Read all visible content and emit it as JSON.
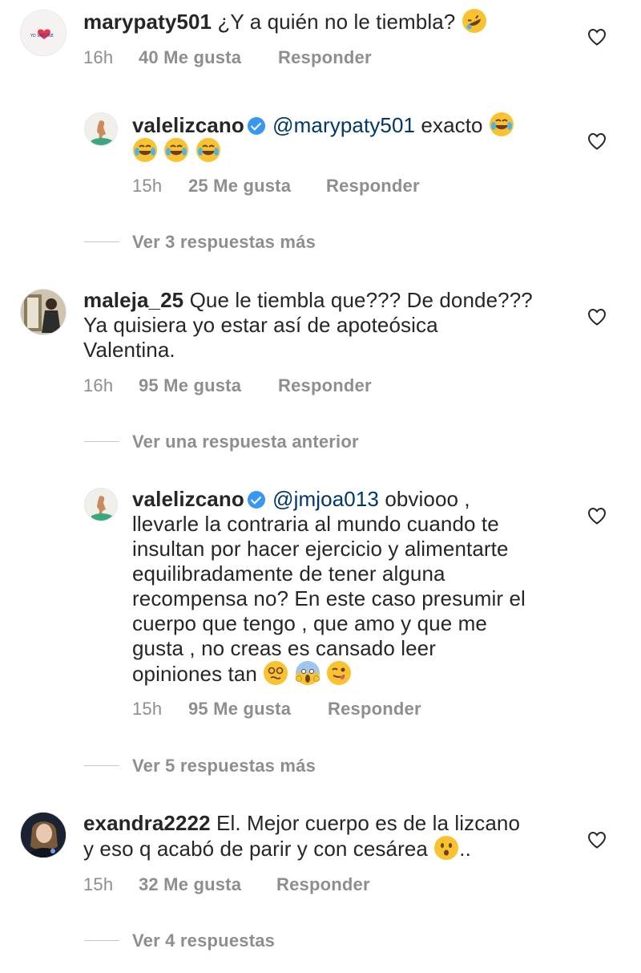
{
  "comments": [
    {
      "username": "marypaty501",
      "text": "¿Y a quién no le tiembla?",
      "emoji": "rolling-on-floor-laughing",
      "time": "16h",
      "likes": "40 Me gusta",
      "reply": "Responder",
      "avatar_logo": "YO VACUNÉ"
    },
    {
      "username": "valelizcano",
      "verified": true,
      "mention": "@marypaty501",
      "text": "exacto",
      "emojis": [
        "face-with-tears-of-joy",
        "face-with-tears-of-joy",
        "face-with-tears-of-joy",
        "face-with-tears-of-joy"
      ],
      "time": "15h",
      "likes": "25 Me gusta",
      "reply": "Responder"
    },
    {
      "username": "maleja_25",
      "text_lines": [
        "Que le tiembla que??? De donde???",
        "Ya quisiera yo estar así de apoteósica",
        "Valentina."
      ],
      "time": "16h",
      "likes": "95 Me gusta",
      "reply": "Responder"
    },
    {
      "username": "valelizcano",
      "verified": true,
      "mention": "@jmjoa013",
      "text_lines": [
        "obviooo ,",
        "llevarle la contraria al mundo cuando te",
        "insultan por hacer ejercicio y alimentarte",
        "equilibradamente de tener alguna",
        "recompensa no? En este caso presumir el",
        "cuerpo que tengo , que amo y que me",
        "gusta , no creas es cansado leer",
        "opiniones tan"
      ],
      "emojis": [
        "woozy-face",
        "face-screaming-in-fear",
        "winking-face-with-tongue"
      ],
      "time": "15h",
      "likes": "95 Me gusta",
      "reply": "Responder"
    },
    {
      "username": "exandra2222",
      "text_lines": [
        "El. Mejor cuerpo es de la lizcano",
        "y eso q acabó de parir y con cesárea",
        ".."
      ],
      "emoji": "hushed-face",
      "time": "15h",
      "likes": "32 Me gusta",
      "reply": "Responder"
    }
  ],
  "view_more": [
    "Ver 3 respuestas más",
    "Ver una respuesta anterior",
    "Ver 5 respuestas más",
    "Ver 4 respuestas"
  ],
  "colors": {
    "username": "#262626",
    "mention": "#00376b",
    "meta": "#8e8e8e",
    "verified": "#3897f0"
  }
}
